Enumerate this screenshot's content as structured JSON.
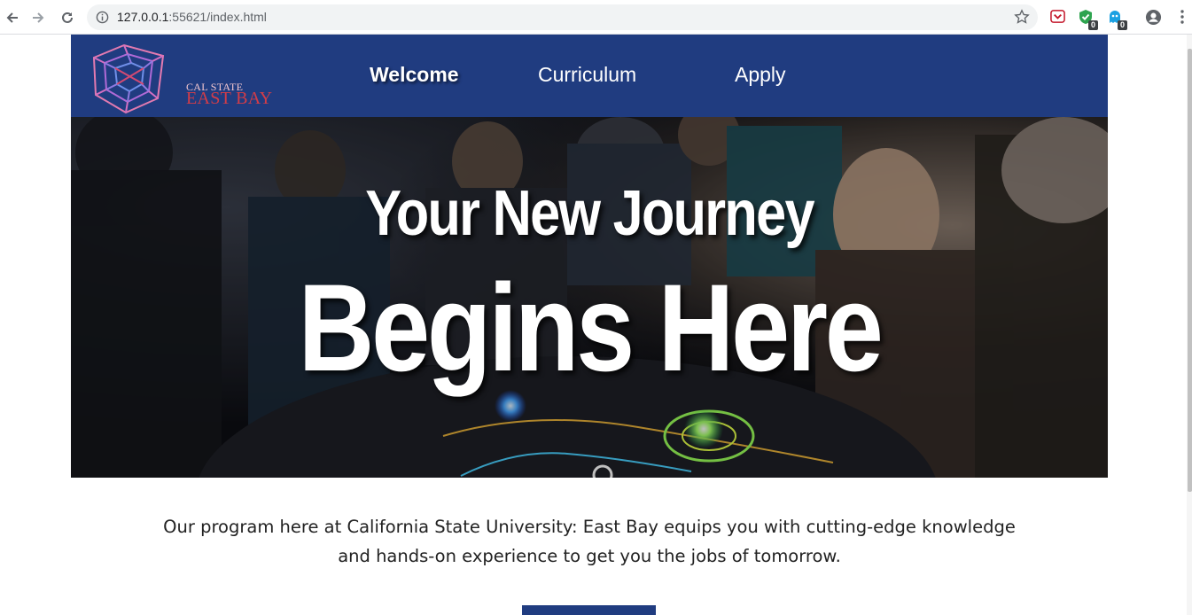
{
  "browser": {
    "url_host": "127.0.0.1",
    "url_rest": ":55621/index.html",
    "extensions": [
      {
        "name": "pocket-icon",
        "badge": ""
      },
      {
        "name": "shield-check-icon",
        "badge": "0"
      },
      {
        "name": "ghost-icon",
        "badge": "0"
      }
    ]
  },
  "site": {
    "logo": {
      "line1": "CAL STATE",
      "line2": "EAST BAY"
    },
    "nav": [
      {
        "label": "Welcome",
        "active": true
      },
      {
        "label": "Curriculum",
        "active": false
      },
      {
        "label": "Apply",
        "active": false
      }
    ],
    "hero": {
      "line1": "Your New Journey",
      "line2": "Begins Here"
    },
    "intro": "Our program here at California State University: East Bay equips you with cutting-edge knowledge and hands-on experience to get you the jobs of tomorrow."
  },
  "colors": {
    "brand_navy": "#203c80",
    "logo_red": "#d23c48",
    "logo_pink": "#f4c8d0"
  }
}
